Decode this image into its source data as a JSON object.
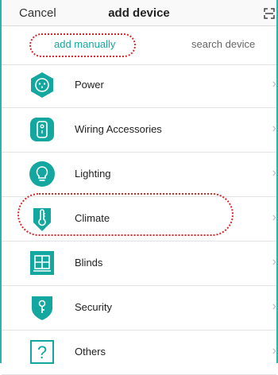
{
  "header": {
    "cancel_label": "Cancel",
    "title": "add device",
    "scan_icon": "scan-icon"
  },
  "tabs": [
    {
      "label": "add manually",
      "active": true
    },
    {
      "label": "search device",
      "active": false
    }
  ],
  "categories": [
    {
      "label": "Power",
      "icon": "power-socket-icon"
    },
    {
      "label": "Wiring Accessories",
      "icon": "wall-switch-icon"
    },
    {
      "label": "Lighting",
      "icon": "lightbulb-icon"
    },
    {
      "label": "Climate",
      "icon": "thermometer-icon"
    },
    {
      "label": "Blinds",
      "icon": "window-blinds-icon"
    },
    {
      "label": "Security",
      "icon": "security-shield-icon"
    },
    {
      "label": "Others",
      "icon": "question-icon"
    }
  ],
  "chevron": "›",
  "colors": {
    "accent": "#14a79f",
    "frame": "#2bb3ad",
    "highlight": "#d52a2a"
  }
}
